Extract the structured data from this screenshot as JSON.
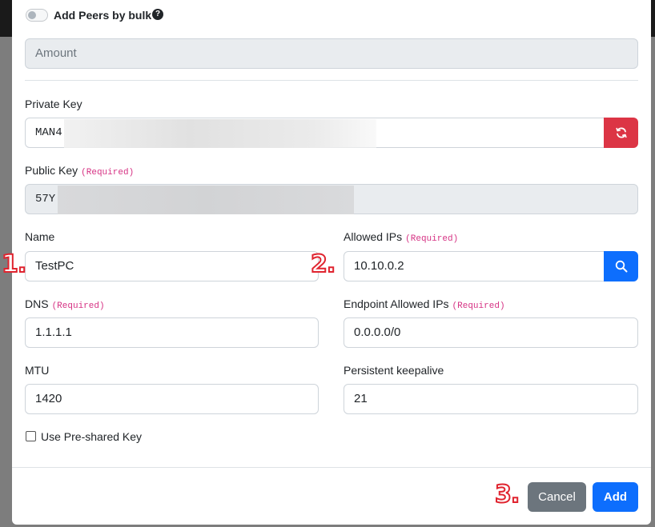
{
  "modal": {
    "bulk_toggle": {
      "label": "Add Peers by bulk",
      "help_glyph": "?",
      "checked": false
    },
    "amount": {
      "placeholder": "Amount"
    },
    "private_key": {
      "label": "Private Key",
      "value": "MAN4"
    },
    "public_key": {
      "label": "Public Key",
      "required": "(Required)",
      "value": "57Y"
    },
    "name": {
      "label": "Name",
      "value": "TestPC"
    },
    "allowed_ips": {
      "label": "Allowed IPs",
      "required": "(Required)",
      "value": "10.10.0.2"
    },
    "dns": {
      "label": "DNS",
      "required": "(Required)",
      "value": "1.1.1.1"
    },
    "endpoint_allowed_ips": {
      "label": "Endpoint Allowed IPs",
      "required": "(Required)",
      "value": "0.0.0.0/0"
    },
    "mtu": {
      "label": "MTU",
      "value": "1420"
    },
    "keepalive": {
      "label": "Persistent keepalive",
      "value": "21"
    },
    "preshared": {
      "label": "Use Pre-shared Key",
      "checked": false
    },
    "buttons": {
      "cancel": "Cancel",
      "add": "Add"
    }
  },
  "annotations": {
    "step1": "1.",
    "step2": "2.",
    "step3": "3."
  },
  "colors": {
    "primary": "#0d6efd",
    "danger": "#dc3545",
    "secondary": "#6c757d",
    "required": "#d63384",
    "annotation": "#e0242f"
  },
  "icons": {
    "refresh": "refresh-icon",
    "search": "search-icon",
    "help": "question-circle-icon"
  }
}
